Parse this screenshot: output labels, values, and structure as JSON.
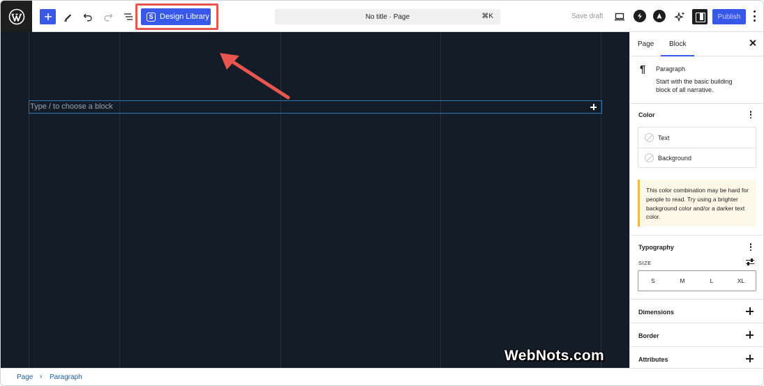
{
  "toolbar": {
    "design_library_label": "Design Library",
    "command_bar_text": "No title · Page",
    "command_shortcut": "⌘K",
    "save_draft_label": "Save draft",
    "publish_label": "Publish"
  },
  "canvas": {
    "block_placeholder": "Type / to choose a block",
    "watermark": "WebNots.com"
  },
  "sidebar": {
    "tabs": [
      {
        "label": "Page"
      },
      {
        "label": "Block"
      }
    ],
    "active_tab": "Block",
    "block": {
      "title": "Paragraph",
      "description": "Start with the basic building block of all narrative."
    },
    "color": {
      "title": "Color",
      "items": [
        {
          "label": "Text"
        },
        {
          "label": "Background"
        }
      ],
      "warning": "This color combination may be hard for people to read. Try using a brighter background color and/or a darker text color."
    },
    "typography": {
      "title": "Typography",
      "size_label": "SIZE",
      "sizes": [
        "S",
        "M",
        "L",
        "XL"
      ]
    },
    "panels": [
      {
        "label": "Dimensions"
      },
      {
        "label": "Border"
      },
      {
        "label": "Attributes"
      }
    ]
  },
  "footer": {
    "breadcrumbs": [
      "Page",
      "Paragraph"
    ],
    "separator": "›"
  },
  "colors": {
    "accent": "#3858e9",
    "canvas_bg": "#141c27",
    "highlight": "#e8554e",
    "warning_border": "#f0b849"
  }
}
